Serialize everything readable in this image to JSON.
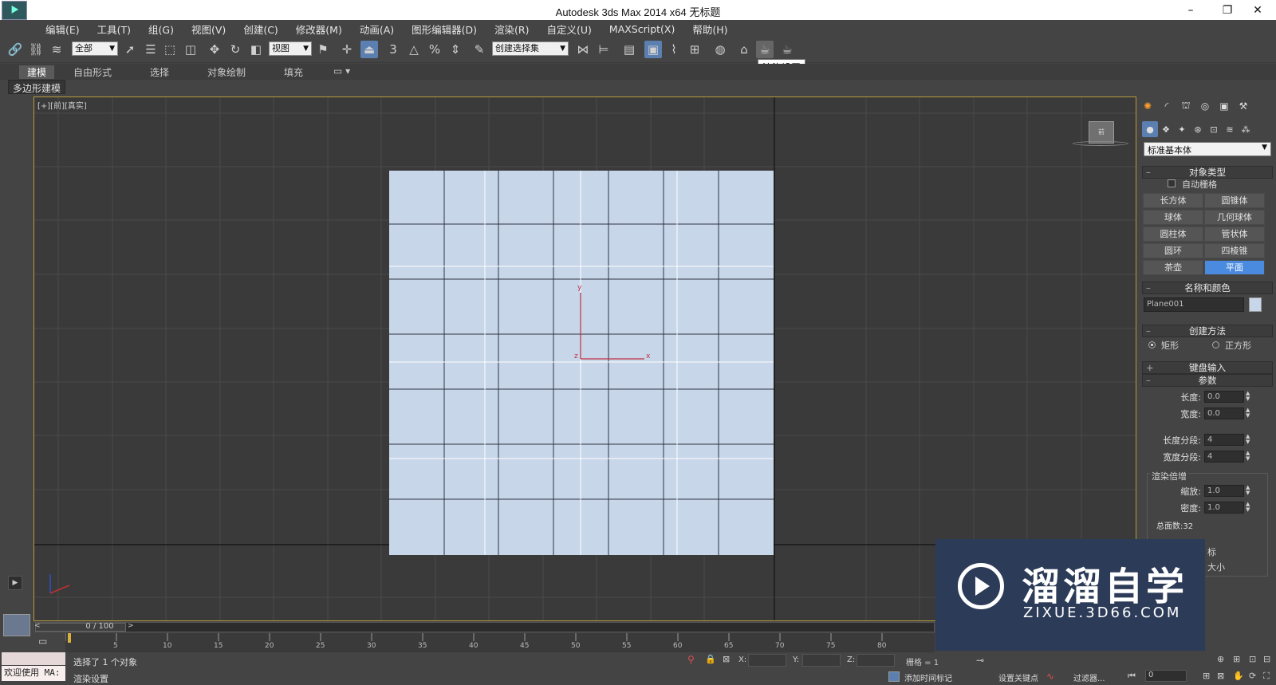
{
  "window": {
    "title": "Autodesk 3ds Max  2014 x64      无标题",
    "logo_icon": "3ds-max-logo-icon",
    "min_glyph": "–",
    "max_glyph": "❐",
    "close_glyph": "✕"
  },
  "menu": [
    "编辑(E)",
    "工具(T)",
    "组(G)",
    "视图(V)",
    "创建(C)",
    "修改器(M)",
    "动画(A)",
    "图形编辑器(D)",
    "渲染(R)",
    "自定义(U)",
    "MAXScript(X)",
    "帮助(H)"
  ],
  "toolbar": {
    "selection_filter": "全部",
    "ref_coord": "视图",
    "named_selection": "创建选择集",
    "snap_label": "3",
    "angle_snap_label": "△",
    "percent_snap_label": "%",
    "tooltip": "渲染设置"
  },
  "ribbon": {
    "tabs": [
      "建模",
      "自由形式",
      "选择",
      "对象绘制",
      "填充"
    ],
    "active_tab": "建模",
    "sub_label": "多边形建模"
  },
  "viewport": {
    "label": "[+][前][真实]",
    "axis_y": "y",
    "axis_x": "x",
    "axis_z": "z",
    "viewcube_label": "前",
    "plane_color": "#c8d6ea",
    "frame_color": "#b89a3a"
  },
  "command_panel": {
    "category_dropdown": "标准基本体",
    "object_type": {
      "title": "对象类型",
      "auto_grid": "自动栅格",
      "buttons": [
        "长方体",
        "圆锥体",
        "球体",
        "几何球体",
        "圆柱体",
        "管状体",
        "圆环",
        "四棱锥",
        "茶壶",
        "平面"
      ],
      "active": "平面"
    },
    "name_color": {
      "title": "名称和颜色",
      "name": "Plane001",
      "swatch": "#c8d6ea"
    },
    "creation_method": {
      "title": "创建方法",
      "options": [
        "矩形",
        "正方形"
      ],
      "selected": "矩形"
    },
    "keyboard_entry": "键盘输入",
    "parameters": {
      "title": "参数",
      "length_label": "长度:",
      "length": "0.0",
      "width_label": "宽度:",
      "width": "0.0",
      "length_segs_label": "长度分段:",
      "length_segs": "4",
      "width_segs_label": "宽度分段:",
      "width_segs": "4",
      "render_group": "渲染倍增",
      "scale_label": "缩放:",
      "scale": "1.0",
      "density_label": "密度:",
      "density": "1.0",
      "faces_label": "总面数:",
      "faces": "32",
      "partial_1": "标",
      "partial_2": "大小"
    }
  },
  "timeline": {
    "frame_label": "0 / 100",
    "ticks": [
      "5",
      "10",
      "15",
      "20",
      "25",
      "30",
      "35",
      "40",
      "45",
      "50",
      "55",
      "60",
      "65",
      "70",
      "75",
      "80"
    ]
  },
  "status": {
    "welcome": "欢迎使用 MA:",
    "line1": "选择了 1 个对象",
    "line2": "渲染设置",
    "x_label": "X:",
    "y_label": "Y:",
    "z_label": "Z:",
    "grid_label": "栅格 = 1",
    "add_time_tag": "添加时间标记",
    "set_key": "设置关键点",
    "filters": "过滤器...",
    "frame_input": "0"
  },
  "watermark": {
    "title": "溜溜自学",
    "subtitle": "ZIXUE.3D66.COM",
    "bg_color": "#2c3b57"
  }
}
